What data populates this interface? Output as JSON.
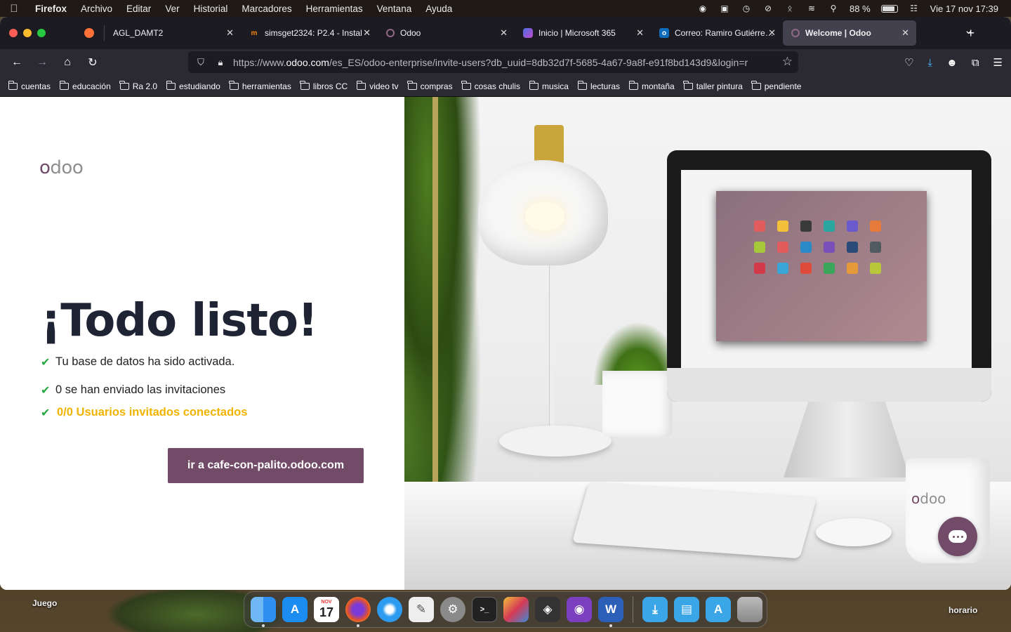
{
  "menubar": {
    "app": "Firefox",
    "items": [
      "Archivo",
      "Editar",
      "Ver",
      "Historial",
      "Marcadores",
      "Herramientas",
      "Ventana",
      "Ayuda"
    ],
    "battery": "88 %",
    "datetime": "Vie 17 nov  17:39"
  },
  "tabs": [
    {
      "label": "AGL_DAMT2",
      "icon": "tab-icon",
      "color": "#1c1b22"
    },
    {
      "label": "simsget2324: P2.4 - Instal",
      "icon": "moodle-icon",
      "color": "#f98012"
    },
    {
      "label": "Odoo",
      "icon": "odoo-icon",
      "color": "#714b67"
    },
    {
      "label": "Inicio | Microsoft 365",
      "icon": "m365-icon",
      "color": "#4a6ee0"
    },
    {
      "label": "Correo: Ramiro Gutiérrez V",
      "icon": "outlook-icon",
      "color": "#0f6cbd"
    },
    {
      "label": "Welcome | Odoo",
      "icon": "odoo-icon",
      "color": "#714b67"
    }
  ],
  "url": {
    "prefix": "https://www.",
    "host": "odoo.com",
    "path": "/es_ES/odoo-enterprise/invite-users?db_uuid=8db32d7f-5685-4a67-9a8f-e91f8bd143d9&login=r"
  },
  "bookmarks": [
    "cuentas",
    "educación",
    "Ra 2.0",
    "estudiando",
    "herramientas",
    "libros CC",
    "video tv",
    "compras",
    "cosas chulis",
    "musica",
    "lecturas",
    "montaña",
    "taller pintura",
    "pendiente"
  ],
  "page": {
    "logo": "odoo",
    "title": "¡Todo listo!",
    "lines": [
      "Tu base de datos ha sido activada.",
      "0 se han enviado las invitaciones"
    ],
    "connected_count": "0/0",
    "connected_label": " Usuarios invitados conectados",
    "cta": "ir a cafe-con-palito.odoo.com"
  },
  "hero": {
    "mug_logo": "odoo"
  },
  "desktop": {
    "left_label": "Juego",
    "right_label": "horario"
  },
  "dock": [
    {
      "name": "finder-icon",
      "color": "#2f8ff0"
    },
    {
      "name": "app-store-icon",
      "color": "#1d8cf0"
    },
    {
      "name": "calendar-icon",
      "color": "#ffffff"
    },
    {
      "name": "firefox-icon",
      "color": "#e2522c"
    },
    {
      "name": "safari-icon",
      "color": "#2d9bf0"
    },
    {
      "name": "textedit-icon",
      "color": "#eeeeee"
    },
    {
      "name": "system-settings-icon",
      "color": "#8a8a8a"
    },
    {
      "name": "terminal-icon",
      "color": "#222222"
    },
    {
      "name": "cube-app-icon",
      "color": "#d63a55"
    },
    {
      "name": "unity-icon",
      "color": "#333333"
    },
    {
      "name": "github-desktop-icon",
      "color": "#7b3fbf"
    },
    {
      "name": "word-icon",
      "color": "#2b5fb8"
    },
    {
      "name": "downloads-folder-icon",
      "color": "#3aa6e8"
    },
    {
      "name": "documents-folder-icon",
      "color": "#3aa6e8"
    },
    {
      "name": "applications-folder-icon",
      "color": "#3aa6e8"
    },
    {
      "name": "trash-icon",
      "color": "#9a9a9a"
    }
  ],
  "calendar": {
    "month": "NOV",
    "day": "17"
  },
  "colors": {
    "brand": "#714b67",
    "success": "#28a745",
    "warning": "#f0b400"
  }
}
